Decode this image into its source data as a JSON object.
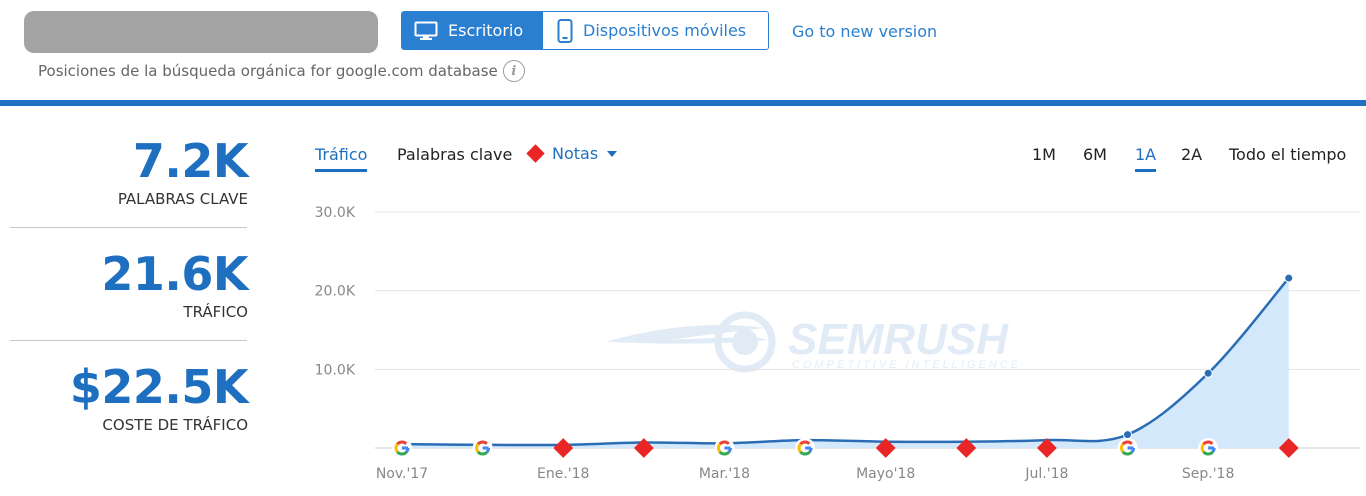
{
  "header": {
    "device_tabs": [
      {
        "label": "Escritorio",
        "icon": "desktop-icon",
        "active": true
      },
      {
        "label": "Dispositivos móviles",
        "icon": "mobile-icon",
        "active": false
      }
    ],
    "new_version_link": "Go to new version",
    "subtitle": "Posiciones de la búsqueda orgánica for google.com database",
    "info_icon": "i",
    "accent_color": "#1f6fc3"
  },
  "metrics": [
    {
      "value": "7.2K",
      "label": "PALABRAS CLAVE"
    },
    {
      "value": "21.6K",
      "label": "TRÁFICO"
    },
    {
      "value": "$22.5K",
      "label": "COSTE DE TRÁFICO"
    }
  ],
  "chart_tabs": {
    "traffic": "Tráfico",
    "keywords": "Palabras clave",
    "notes": "Notas",
    "active": "Tráfico"
  },
  "periods": [
    {
      "label": "1M",
      "active": false
    },
    {
      "label": "6M",
      "active": false
    },
    {
      "label": "1A",
      "active": true
    },
    {
      "label": "2A",
      "active": false
    },
    {
      "label": "Todo el tiempo",
      "active": false
    }
  ],
  "watermark": {
    "brand": "SEMRUSH",
    "tagline": "COMPETITIVE INTELLIGENCE"
  },
  "chart_data": {
    "type": "area",
    "ylim": [
      0,
      30000
    ],
    "y_ticks": [
      10000,
      20000,
      30000
    ],
    "y_tick_labels": [
      "10.0K",
      "20.0K",
      "30.0K"
    ],
    "x_range": [
      0,
      11.4
    ],
    "x_ticks": [
      0,
      2,
      4,
      6,
      8,
      10
    ],
    "x_tick_labels": [
      "Nov.'17",
      "Ene.'18",
      "Mar.'18",
      "Mayo'18",
      "Jul.'18",
      "Sep.'18"
    ],
    "series": [
      {
        "x": [
          0,
          1,
          2,
          3,
          4,
          5,
          6,
          7,
          8,
          9,
          10,
          11
        ],
        "values": [
          500,
          400,
          400,
          700,
          600,
          1000,
          800,
          800,
          1000,
          1700,
          9500,
          21600
        ],
        "color": "#2a6db5",
        "fill": "#d4e8fb"
      }
    ],
    "point_markers_at": [
      9,
      10,
      11
    ],
    "markers": [
      {
        "x": 0,
        "type": "google"
      },
      {
        "x": 1,
        "type": "google"
      },
      {
        "x": 2,
        "type": "note"
      },
      {
        "x": 3,
        "type": "note"
      },
      {
        "x": 4,
        "type": "google"
      },
      {
        "x": 5,
        "type": "google"
      },
      {
        "x": 6,
        "type": "note"
      },
      {
        "x": 7,
        "type": "note"
      },
      {
        "x": 8,
        "type": "note"
      },
      {
        "x": 9,
        "type": "google"
      },
      {
        "x": 10,
        "type": "google"
      },
      {
        "x": 11,
        "type": "note"
      }
    ],
    "grid": true
  }
}
